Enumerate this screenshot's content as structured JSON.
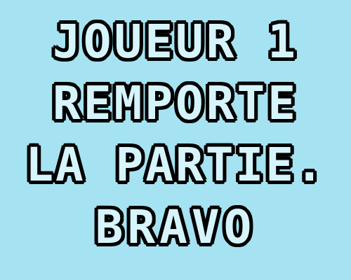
{
  "message": {
    "line1": "JOUEUR 1",
    "line2": "REMPORTE",
    "line3": "LA PARTIE.",
    "line4": "BRAVO"
  },
  "colors": {
    "background": "#a6e3f2",
    "text_fill": "#d6f4fc",
    "text_outline": "#000000"
  }
}
